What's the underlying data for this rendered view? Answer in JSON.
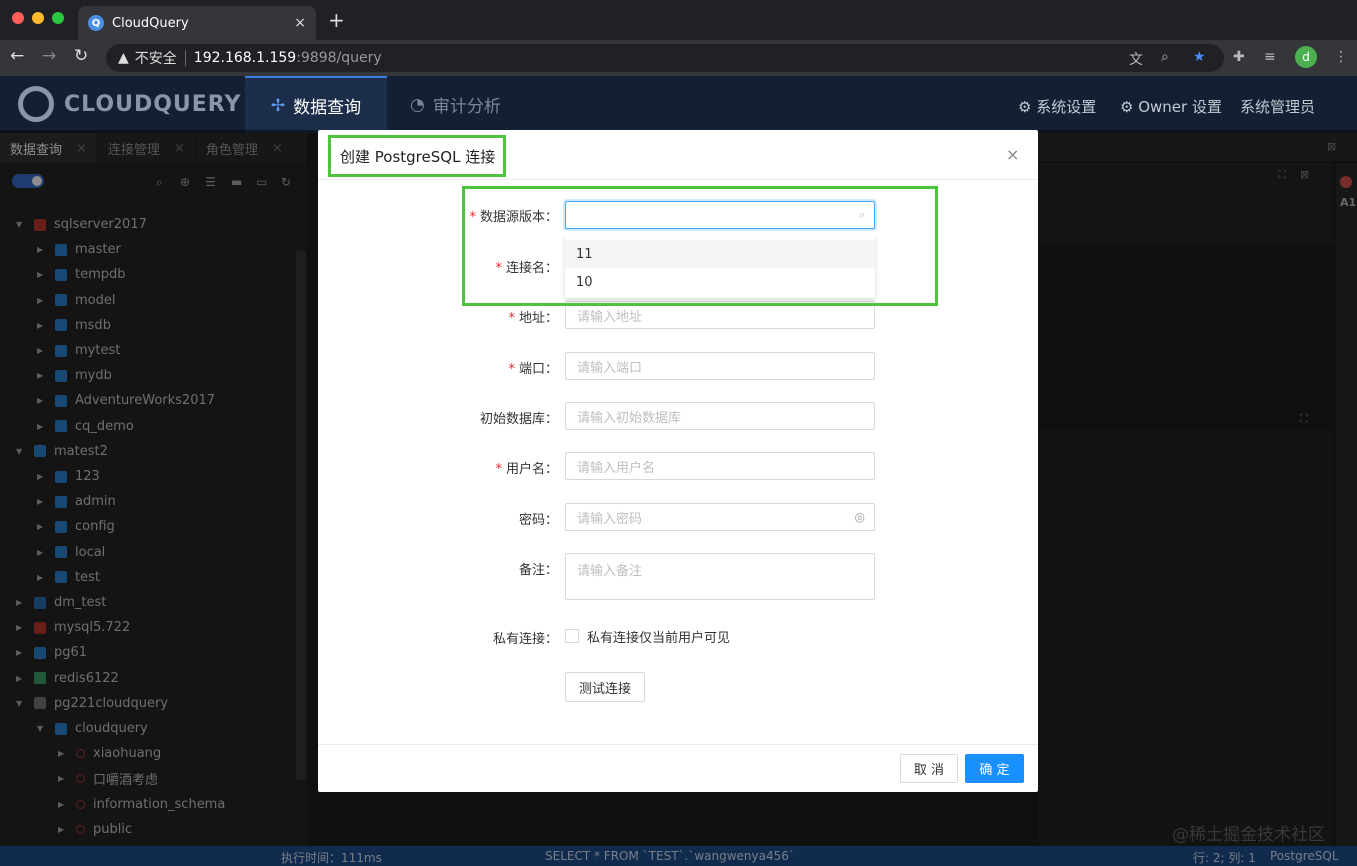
{
  "browser": {
    "tab_title": "CloudQuery",
    "tab_close": "×",
    "new_tab": "+",
    "insecure_label": "不安全",
    "url_host": "192.168.1.159",
    "url_path": ":9898/query",
    "profile_initial": "d"
  },
  "app": {
    "logo_text": "CLOUDQUERY",
    "nav": [
      {
        "label": "数据查询"
      },
      {
        "label": "审计分析"
      }
    ],
    "header_right": [
      {
        "label": "系统设置"
      },
      {
        "label": "Owner 设置"
      },
      {
        "label": "系统管理员"
      }
    ]
  },
  "left_tabs": [
    {
      "label": "数据查询"
    },
    {
      "label": "连接管理"
    },
    {
      "label": "角色管理"
    }
  ],
  "tree": [
    {
      "label": "sqlserver2017",
      "level": 0,
      "expanded": true
    },
    {
      "label": "master",
      "level": 1
    },
    {
      "label": "tempdb",
      "level": 1
    },
    {
      "label": "model",
      "level": 1
    },
    {
      "label": "msdb",
      "level": 1
    },
    {
      "label": "mytest",
      "level": 1
    },
    {
      "label": "mydb",
      "level": 1
    },
    {
      "label": "AdventureWorks2017",
      "level": 1
    },
    {
      "label": "cq_demo",
      "level": 1
    },
    {
      "label": "matest2",
      "level": 0,
      "expanded": true
    },
    {
      "label": "123",
      "level": 1
    },
    {
      "label": "admin",
      "level": 1
    },
    {
      "label": "config",
      "level": 1
    },
    {
      "label": "local",
      "level": 1
    },
    {
      "label": "test",
      "level": 1
    },
    {
      "label": "dm_test",
      "level": 0
    },
    {
      "label": "mysql5.722",
      "level": 0
    },
    {
      "label": "pg61",
      "level": 0
    },
    {
      "label": "redis6122",
      "level": 0
    },
    {
      "label": "pg221cloudquery",
      "level": 0,
      "expanded": true
    },
    {
      "label": "cloudquery",
      "level": 1,
      "expanded": true
    },
    {
      "label": "xiaohuang",
      "level": 2
    },
    {
      "label": "口嚼酒考虑",
      "level": 2
    },
    {
      "label": "information_schema",
      "level": 2
    },
    {
      "label": "public",
      "level": 2
    }
  ],
  "status": {
    "exec_time": "执行时间：111ms",
    "query": "SELECT * FROM `TEST`.`wangwenya456`",
    "position": "行: 2; 列: 1",
    "dialect": "PostgreSQL"
  },
  "side_label": "A1",
  "watermark": "@稀土掘金技术社区",
  "modal": {
    "title": "创建 PostgreSQL 连接",
    "close": "×",
    "fields": {
      "version": {
        "label": "数据源版本",
        "value": ""
      },
      "name": {
        "label": "连接名"
      },
      "address": {
        "label": "地址",
        "placeholder": "请输入地址"
      },
      "port": {
        "label": "端口",
        "placeholder": "请输入端口"
      },
      "initdb": {
        "label": "初始数据库",
        "placeholder": "请输入初始数据库"
      },
      "username": {
        "label": "用户名",
        "placeholder": "请输入用户名"
      },
      "password": {
        "label": "密码",
        "placeholder": "请输入密码"
      },
      "remarks": {
        "label": "备注",
        "placeholder": "请输入备注"
      },
      "private": {
        "label": "私有连接",
        "checkbox_label": "私有连接仅当前用户可见",
        "checked": false
      }
    },
    "version_options": [
      {
        "label": "11"
      },
      {
        "label": "10"
      }
    ],
    "test_button": "测试连接",
    "cancel_button": "取 消",
    "ok_button": "确 定",
    "colon": "："
  },
  "colors": {
    "accent": "#1890ff",
    "highlight_green": "#4bc63a",
    "required": "#f5222d",
    "header_bg": "#132033"
  }
}
